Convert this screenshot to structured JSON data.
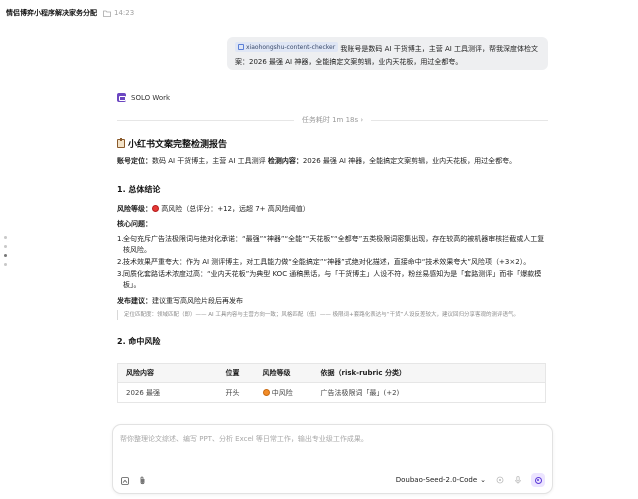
{
  "titlebar": {
    "title": "情侣博弈小程序解决家务分配",
    "time": "14:23"
  },
  "user_message": {
    "tag": "xiaohongshu-content-checker",
    "text": " 我账号是数码 AI 干货博主，主营 AI 工具测评，帮我深度体检文案：2026 最强 AI 神器，全能搞定文案剪辑，业内天花板，用过全都夸。"
  },
  "assistant": {
    "name": "SOLO Work"
  },
  "duration": {
    "label": "任务耗时 1m 18s",
    "chevron": "›"
  },
  "report": {
    "title": "小红书文案完整检测报告",
    "meta_label1": "账号定位：",
    "meta_value1": "数码 AI 干货博主，主营 AI 工具测评 ",
    "meta_label2": "检测内容：",
    "meta_value2": "2026 最强 AI 神器，全能搞定文案剪辑，业内天花板，用过全都夸。",
    "section1_title": "1. 总体结论",
    "risk_label": "风险等级：",
    "risk_value": " 高风险（总评分：+12，远超 7+ 高风险阈值）",
    "core_label": "核心问题：",
    "issues": [
      {
        "n": "1.",
        "text": "全句充斥广告法极限词与绝对化承诺：“最强”“神器”“全能”“天花板”“全都夸”五类极限词密集出现，存在较高的被机器审核拦截或人工复核风险。"
      },
      {
        "n": "2.",
        "text": "技术效果严重夸大：作为 AI 测评博主，对工具能力做“全能搞定”“神器”式绝对化描述，直接命中“技术效果夸大”风险项（+3×2）。"
      },
      {
        "n": "3.",
        "text": "同质化套路话术浓度过高：“业内天花板”为典型 KOC 通稿黑话，与「干货博主」人设不符，粉丝易感知为是「套路测评」而非「爆款模板」。"
      }
    ],
    "advice_label": "发布建议：",
    "advice_value": "建议重写高风险片段后再发布",
    "quote": "定位匹配度：领域匹配（即）—— AI 工具内容与主营方向一致；风格匹配（低）—— 极限词+套路化表达与“干货”人设反差较大，建议回归分享客观的测评语气。",
    "section2_title": "2. 命中风险",
    "table_headers": [
      "风险内容",
      "位置",
      "风险等级",
      "依据（risk-rubric 分类）"
    ],
    "table_rows": [
      {
        "content": "2026 最强",
        "pos": "开头",
        "level": " 中风险",
        "basis": "广告法极限词「最」(+2)"
      }
    ]
  },
  "input": {
    "placeholder": "帮你整理论文综述、编写 PPT、分析 Excel 等日常工作，输出专业级工作成果。",
    "model": "Doubao-Seed-2.0-Code",
    "chevron": "⌄"
  },
  "colors": {
    "accent": "#5b3bd6",
    "high_risk": "#e53935",
    "mid_risk": "#f28c28",
    "bubble_bg": "#eeeff1"
  }
}
